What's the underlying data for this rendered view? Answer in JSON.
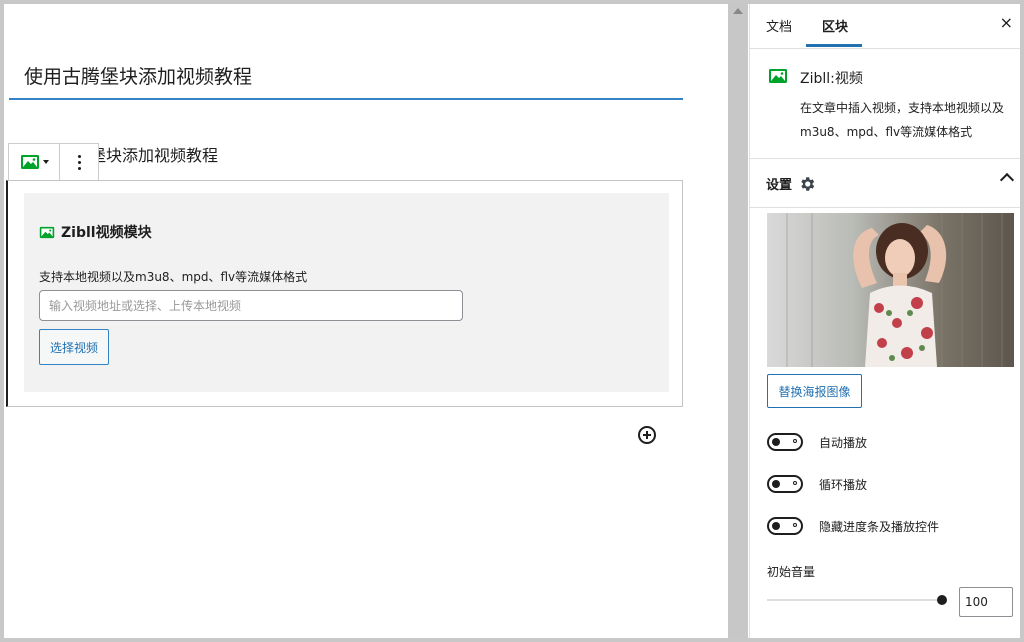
{
  "editor": {
    "post_title": "使用古腾堡块添加视频教程",
    "paragraph": "使用古腾堡块添加视频教程",
    "block": {
      "title": "Zibll视频模块",
      "description": "支持本地视频以及m3u8、mpd、flv等流媒体格式",
      "input_placeholder": "输入视频地址或选择、上传本地视频",
      "input_value": "",
      "select_button": "选择视频"
    }
  },
  "sidebar": {
    "tabs": [
      {
        "label": "文档",
        "active": false
      },
      {
        "label": "区块",
        "active": true
      }
    ],
    "close_icon": "×",
    "block_card": {
      "icon": "video-block-icon",
      "title": "Zibll:视频",
      "description": "在文章中插入视频，支持本地视频以及m3u8、mpd、flv等流媒体格式"
    },
    "settings": {
      "heading": "设置",
      "replace_poster_button": "替换海报图像",
      "toggles": [
        {
          "label": "自动播放",
          "on": false
        },
        {
          "label": "循环播放",
          "on": false
        },
        {
          "label": "隐藏进度条及播放控件",
          "on": false
        }
      ],
      "volume": {
        "label": "初始音量",
        "value": "100",
        "fraction": 1.0
      }
    }
  },
  "colors": {
    "accent": "#2271b1",
    "title_underline": "#3582c4",
    "icon_green": "#00a32a"
  }
}
